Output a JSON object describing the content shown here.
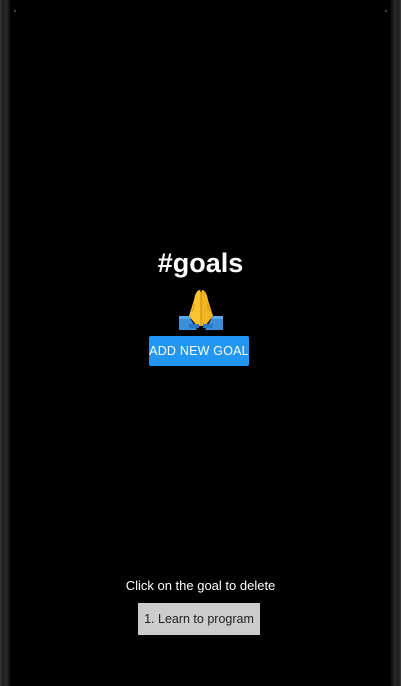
{
  "header": {
    "title": "#goals",
    "emoji": "folded-hands-icon"
  },
  "actions": {
    "add_label": "ADD NEW GOAL",
    "add_color": "#2196f3"
  },
  "goals": {
    "hint": "Click on the goal to delete",
    "items": [
      {
        "label": "1. Learn to program"
      }
    ]
  },
  "colors": {
    "background": "#000000",
    "text": "#ffffff",
    "goal_item_bg": "#cccccc"
  }
}
